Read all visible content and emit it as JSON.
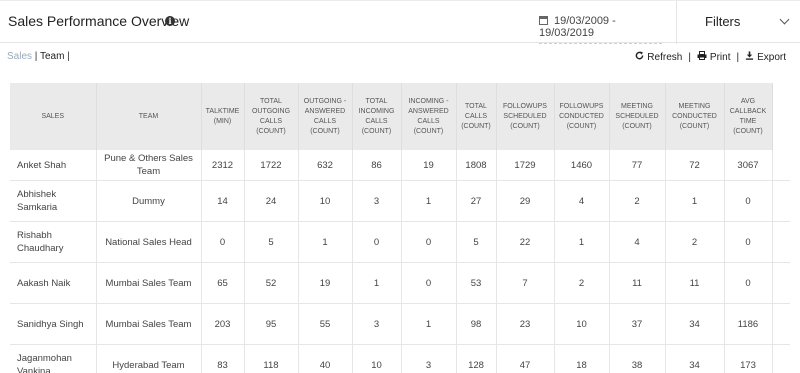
{
  "header": {
    "title": "Sales Performance Overview",
    "info_glyph": "i",
    "date_range": "19/03/2009 - 19/03/2019",
    "filters_label": "Filters"
  },
  "breadcrumb": {
    "sales": "Sales",
    "separator": " | ",
    "team": "Team",
    "trailing": " |"
  },
  "actions": {
    "refresh_label": "Refresh",
    "print_label": "Print",
    "export_label": "Export",
    "separator": "|"
  },
  "table": {
    "columns": [
      "SALES",
      "TEAM",
      "TALKTIME (MIN)",
      "TOTAL OUTGOING CALLS (COUNT)",
      "OUTGOING - ANSWERED CALLS (COUNT)",
      "TOTAL INCOMING CALLS (COUNT)",
      "INCOMING - ANSWERED CALLS (COUNT)",
      "TOTAL CALLS (COUNT)",
      "FOLLOWUPS SCHEDULED (COUNT)",
      "FOLLOWUPS CONDUCTED (COUNT)",
      "MEETING SCHEDULED (COUNT)",
      "MEETING CONDUCTED (COUNT)",
      "AVG CALLBACK TIME (COUNT)"
    ],
    "rows": [
      [
        "Anket Shah",
        "Pune & Others Sales Team",
        "2312",
        "1722",
        "632",
        "86",
        "19",
        "1808",
        "1729",
        "1460",
        "77",
        "72",
        "3067"
      ],
      [
        "Abhishek Samkaria",
        "Dummy",
        "14",
        "24",
        "10",
        "3",
        "1",
        "27",
        "29",
        "4",
        "2",
        "1",
        "0"
      ],
      [
        "Rishabh Chaudhary",
        "National Sales Head",
        "0",
        "5",
        "1",
        "0",
        "0",
        "5",
        "22",
        "1",
        "4",
        "2",
        "0"
      ],
      [
        "Aakash Naik",
        "Mumbai Sales Team",
        "65",
        "52",
        "19",
        "1",
        "0",
        "53",
        "7",
        "2",
        "11",
        "11",
        "0"
      ],
      [
        "Sanidhya Singh",
        "Mumbai Sales Team",
        "203",
        "95",
        "55",
        "3",
        "1",
        "98",
        "23",
        "10",
        "37",
        "34",
        "1186"
      ],
      [
        "Jaganmohan Vankina",
        "Hyderabad Team",
        "83",
        "118",
        "40",
        "10",
        "3",
        "128",
        "47",
        "18",
        "38",
        "34",
        "173"
      ]
    ]
  },
  "icons": {
    "info": "info-icon",
    "calendar": "calendar-icon",
    "chevron": "chevron-down-icon",
    "refresh": "refresh-icon",
    "print": "print-icon",
    "export": "download-icon"
  }
}
